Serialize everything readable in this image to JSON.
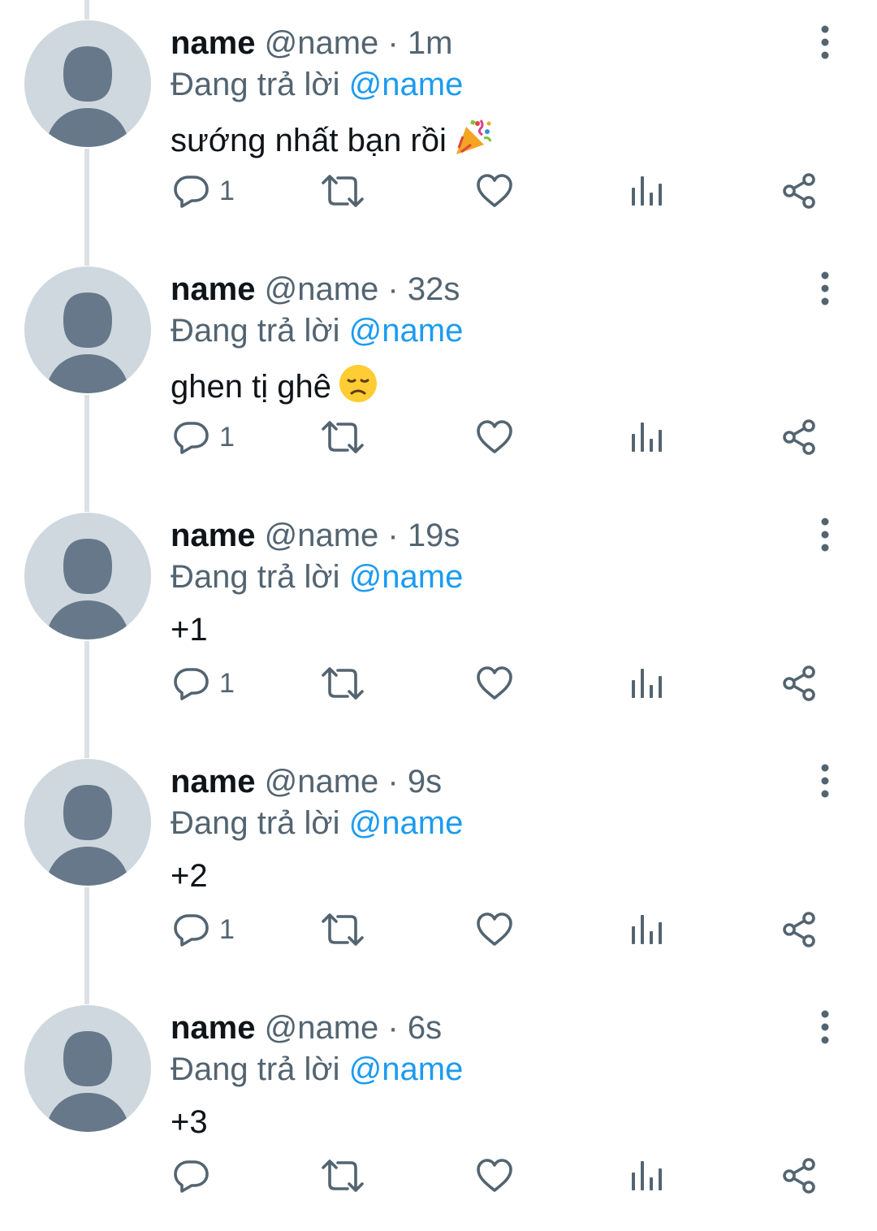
{
  "theme": {
    "text_color": "#0f1419",
    "muted_color": "#536471",
    "mention_color": "#1d9bf0",
    "avatar_bg": "#ced8de",
    "avatar_fg": "#66788a",
    "icon_color": "#536471",
    "thread_line": "#dde1e4"
  },
  "tweets": [
    {
      "display_name": "name",
      "handle": "@name",
      "separator": "·",
      "time": "1m",
      "replying_label": "Đang trả lời",
      "replying_to": "@name",
      "text": "sướng nhất bạn rồi",
      "emoji_icon": "party-popper-icon",
      "reply_count": "1"
    },
    {
      "display_name": "name",
      "handle": "@name",
      "separator": "·",
      "time": "32s",
      "replying_label": "Đang trả lời",
      "replying_to": "@name",
      "text": "ghen tị ghê",
      "emoji_icon": "disappointed-face-icon",
      "reply_count": "1"
    },
    {
      "display_name": "name",
      "handle": "@name",
      "separator": "·",
      "time": "19s",
      "replying_label": "Đang trả lời",
      "replying_to": "@name",
      "text": "+1",
      "reply_count": "1"
    },
    {
      "display_name": "name",
      "handle": "@name",
      "separator": "·",
      "time": "9s",
      "replying_label": "Đang trả lời",
      "replying_to": "@name",
      "text": "+2",
      "reply_count": "1"
    },
    {
      "display_name": "name",
      "handle": "@name",
      "separator": "·",
      "time": "6s",
      "replying_label": "Đang trả lời",
      "replying_to": "@name",
      "text": "+3",
      "reply_count": ""
    }
  ]
}
